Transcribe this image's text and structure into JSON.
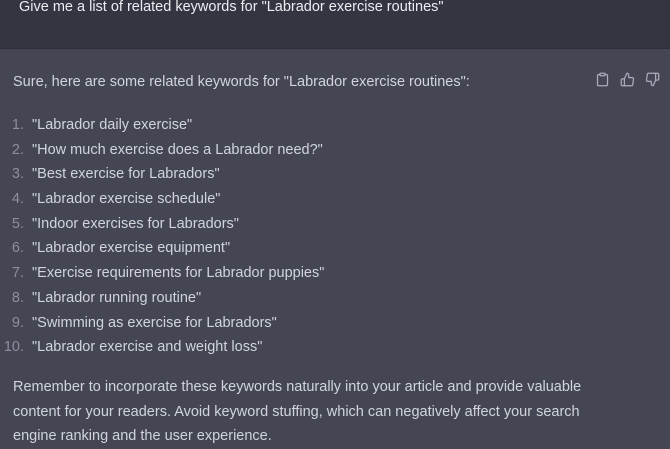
{
  "user_message": {
    "text": "Give me a list of related keywords for \"Labrador exercise routines\""
  },
  "assistant_message": {
    "intro": "Sure, here are some related keywords for \"Labrador exercise routines\":",
    "keywords": [
      {
        "number": "1.",
        "text": "\"Labrador daily exercise\""
      },
      {
        "number": "2.",
        "text": "\"How much exercise does a Labrador need?\""
      },
      {
        "number": "3.",
        "text": "\"Best exercise for Labradors\""
      },
      {
        "number": "4.",
        "text": "\"Labrador exercise schedule\""
      },
      {
        "number": "5.",
        "text": "\"Indoor exercises for Labradors\""
      },
      {
        "number": "6.",
        "text": "\"Labrador exercise equipment\""
      },
      {
        "number": "7.",
        "text": "\"Exercise requirements for Labrador puppies\""
      },
      {
        "number": "8.",
        "text": "\"Labrador running routine\""
      },
      {
        "number": "9.",
        "text": "\"Swimming as exercise for Labradors\""
      },
      {
        "number": "10.",
        "text": "\"Labrador exercise and weight loss\""
      }
    ],
    "closing_lines": [
      "Remember to incorporate these keywords naturally into your article and provide valuable",
      "content for your readers. Avoid keyword stuffing, which can negatively affect your search",
      "engine ranking and the user experience."
    ],
    "actions": [
      {
        "name": "copy-icon"
      },
      {
        "name": "thumbs-up-icon"
      },
      {
        "name": "thumbs-down-icon"
      }
    ]
  },
  "colors": {
    "user_bg": "#343541",
    "assistant_bg": "#444654",
    "text": "#d1d5db",
    "muted": "#8e8ea0"
  }
}
